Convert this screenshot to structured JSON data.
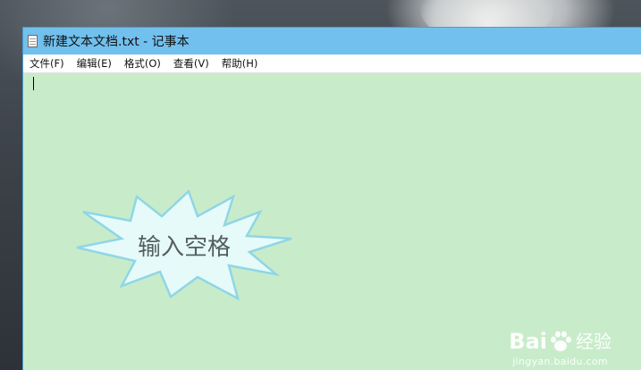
{
  "window": {
    "title": "新建文本文档.txt - 记事本",
    "icon": "notepad-document-icon"
  },
  "menu": {
    "items": [
      {
        "label": "文件(F)"
      },
      {
        "label": "编辑(E)"
      },
      {
        "label": "格式(O)"
      },
      {
        "label": "查看(V)"
      },
      {
        "label": "帮助(H)"
      }
    ]
  },
  "editor": {
    "content": "",
    "background": "#c8ecca"
  },
  "callout": {
    "text": "输入空格",
    "fill": "#e6fafa",
    "stroke": "#8fd6e6"
  },
  "watermark": {
    "logo_text_left": "Bai",
    "logo_text_right": "经验",
    "logo_icon": "baidu-paw-icon",
    "url": "jingyan.baidu.com"
  },
  "colors": {
    "titlebar": "#71c0ee",
    "menubar": "#ffffff"
  }
}
